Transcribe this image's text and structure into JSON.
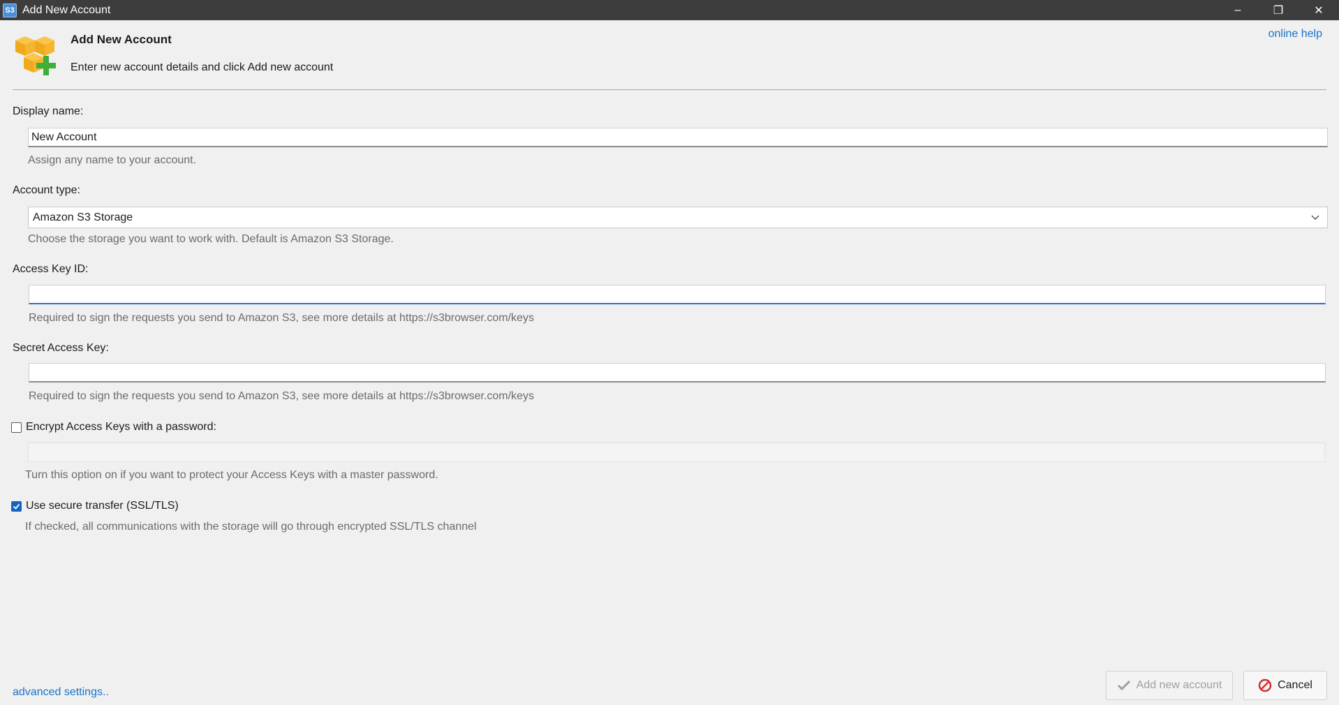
{
  "window": {
    "title": "Add New Account",
    "app_icon_text": "S3",
    "minimize_glyph": "–",
    "restore_glyph": "❐",
    "close_glyph": "✕"
  },
  "header": {
    "title": "Add New Account",
    "subtitle": "Enter new account details and click Add new account",
    "online_help": "online help"
  },
  "display_name": {
    "label": "Display name:",
    "value": "New Account",
    "hint": "Assign any name to your account."
  },
  "account_type": {
    "label": "Account type:",
    "selected": "Amazon S3 Storage",
    "hint": "Choose the storage you want to work with. Default is Amazon S3 Storage."
  },
  "access_key": {
    "label": "Access Key ID:",
    "value": "",
    "hint": "Required to sign the requests you send to Amazon S3, see more details at https://s3browser.com/keys"
  },
  "secret_key": {
    "label": "Secret Access Key:",
    "value": "",
    "hint": "Required to sign the requests you send to Amazon S3, see more details at https://s3browser.com/keys"
  },
  "encrypt": {
    "label": "Encrypt Access Keys with a password:",
    "checked": false,
    "hint": "Turn this option on if you want to protect your Access Keys with a master password."
  },
  "secure": {
    "label": "Use secure transfer (SSL/TLS)",
    "checked": true,
    "hint": "If checked, all communications with the storage will go through encrypted SSL/TLS channel"
  },
  "footer": {
    "advanced": "advanced settings..",
    "add_label": "Add new account",
    "cancel_label": "Cancel"
  },
  "colors": {
    "titlebar": "#3d3d3d",
    "link": "#1a73c8",
    "accent": "#1565c0",
    "cancel_icon": "#d32f2f"
  }
}
